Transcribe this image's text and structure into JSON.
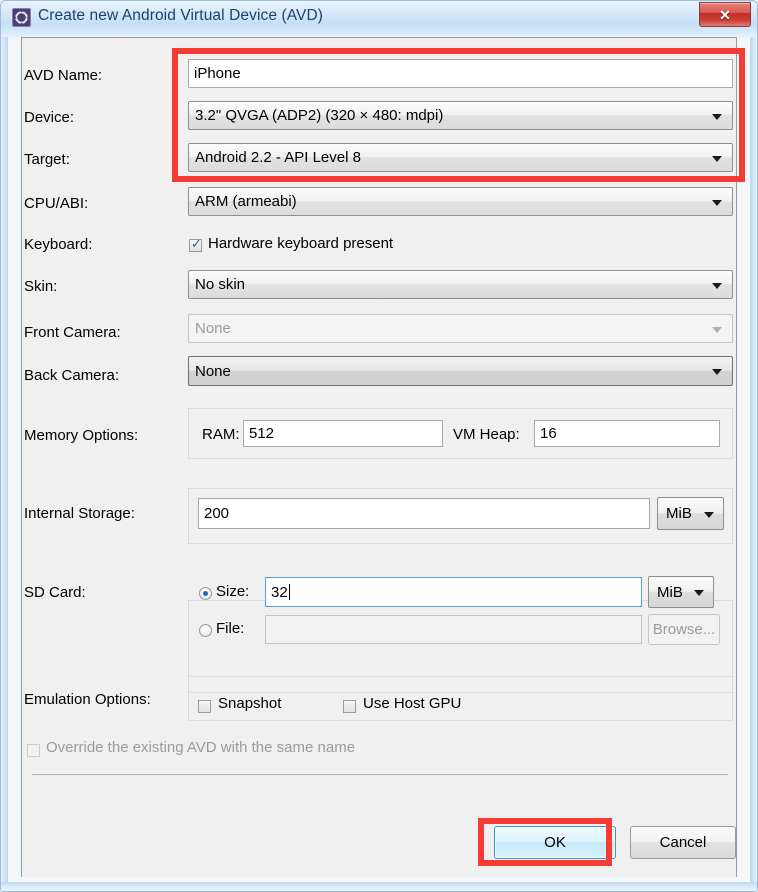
{
  "window": {
    "title": "Create new Android Virtual Device (AVD)",
    "app_icon": "android-avd-gear-icon",
    "close_label": "✕"
  },
  "form": {
    "avd_name": {
      "label": "AVD Name:",
      "value": "iPhone"
    },
    "device": {
      "label": "Device:",
      "value": "3.2\" QVGA (ADP2) (320 × 480: mdpi)"
    },
    "target": {
      "label": "Target:",
      "value": "Android 2.2 - API Level 8"
    },
    "cpu_abi": {
      "label": "CPU/ABI:",
      "value": "ARM (armeabi)"
    },
    "keyboard": {
      "label": "Keyboard:",
      "checkbox_label": "Hardware keyboard present",
      "checked": true
    },
    "skin": {
      "label": "Skin:",
      "value": "No skin"
    },
    "front_camera": {
      "label": "Front Camera:",
      "value": "None",
      "disabled": true
    },
    "back_camera": {
      "label": "Back Camera:",
      "value": "None",
      "disabled": false
    },
    "memory_options": {
      "label": "Memory Options:",
      "ram_label": "RAM:",
      "ram_value": "512",
      "vm_heap_label": "VM Heap:",
      "vm_heap_value": "16"
    },
    "internal_storage": {
      "label": "Internal Storage:",
      "value": "200",
      "unit": "MiB"
    },
    "sd_card": {
      "label": "SD Card:",
      "size_radio_label": "Size:",
      "size_selected": true,
      "size_value": "32",
      "size_unit": "MiB",
      "file_radio_label": "File:",
      "file_selected": false,
      "file_value": "",
      "browse_label": "Browse..."
    },
    "emulation_options": {
      "label": "Emulation Options:",
      "snapshot_label": "Snapshot",
      "snapshot_checked": false,
      "host_gpu_label": "Use Host GPU",
      "host_gpu_checked": false
    },
    "override": {
      "label": "Override the existing AVD with the same name",
      "checked": false,
      "disabled": true
    }
  },
  "buttons": {
    "ok": "OK",
    "cancel": "Cancel"
  },
  "annotations": {
    "accent_color": "#f63b32",
    "highlight_fields": "AVD Name / Device / Target",
    "highlight_button": "OK"
  }
}
